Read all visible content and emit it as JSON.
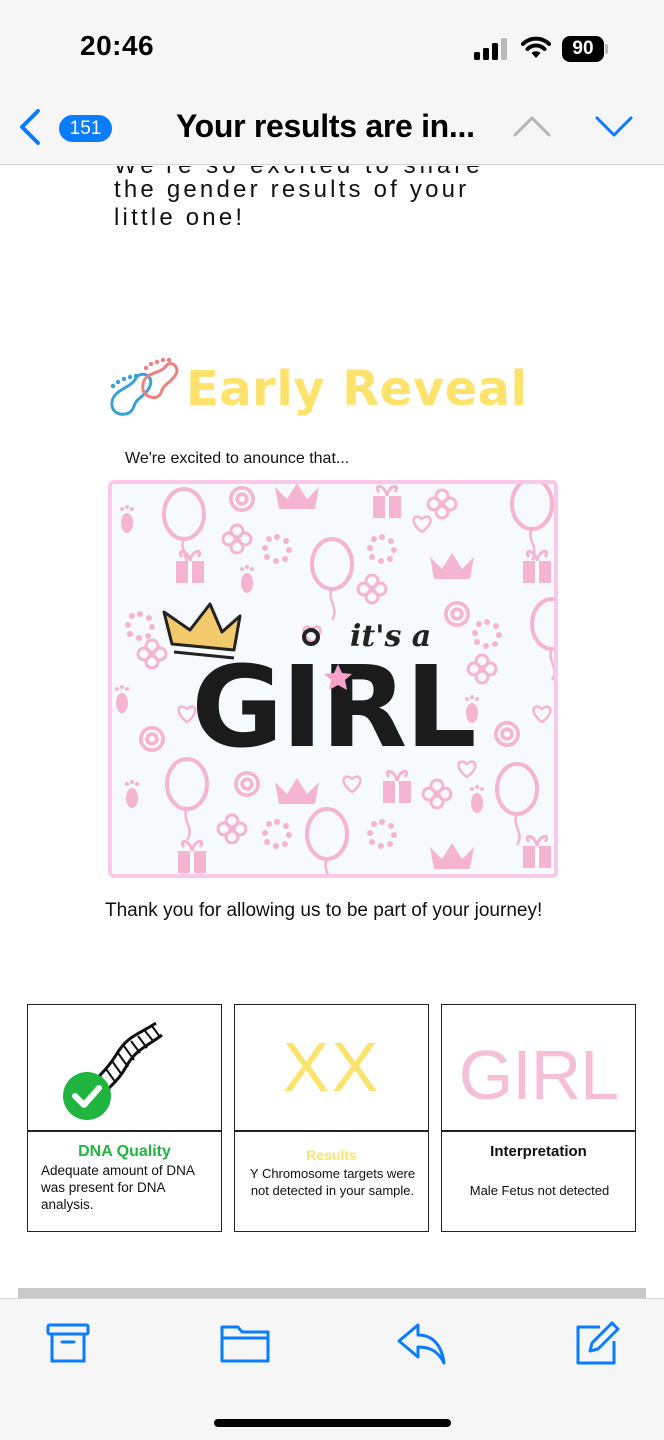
{
  "status_bar": {
    "time": "20:46",
    "battery": "90"
  },
  "nav": {
    "unread_count": "151",
    "title": "Your results are in..."
  },
  "email": {
    "clipped_line": "We're so excited to share",
    "intro": "the gender results of your\nlittle one!",
    "brand": "Early Reveal",
    "announce": "We're excited to anounce that...",
    "reveal_caption": "it's a",
    "reveal_word": "GIRL",
    "thanks": "Thank you for allowing us to be part of your journey!",
    "result_cards": [
      {
        "title": "DNA Quality",
        "description": "Adequate amount of DNA was present for DNA analysis."
      },
      {
        "headline": "XX",
        "title": "Results",
        "description": "Y Chromosome targets were not detected in your sample."
      },
      {
        "headline": "GIRL",
        "title": "Interpretation",
        "description": "Male Fetus not detected"
      }
    ]
  },
  "colors": {
    "accent_blue": "#0a7cff",
    "brand_yellow": "#fde26c",
    "pink": "#f5bfd8",
    "dna_green": "#1fb53f"
  },
  "toolbar": {
    "icons": [
      "archive-icon",
      "folder-icon",
      "reply-icon",
      "compose-icon"
    ]
  }
}
